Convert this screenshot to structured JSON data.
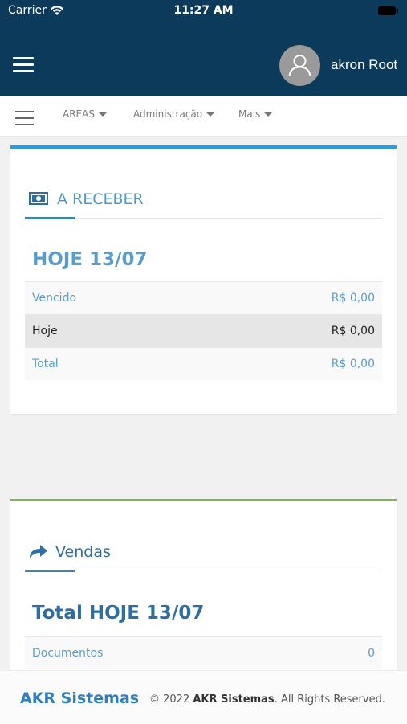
{
  "status_bar": {
    "carrier": "Carrier",
    "time": "11:27 AM"
  },
  "app_bar": {
    "username": "akron Root"
  },
  "nav": {
    "items": [
      {
        "label": "AREAS"
      },
      {
        "label": "Administração"
      },
      {
        "label": "Mais"
      }
    ]
  },
  "receivables_card": {
    "title": "A RECEBER",
    "date_heading": "HOJE 13/07",
    "rows": [
      {
        "label": "Vencido",
        "value": "R$ 0,00"
      },
      {
        "label": "Hoje",
        "value": "R$ 0,00"
      },
      {
        "label": "Total",
        "value": "R$ 0,00"
      }
    ]
  },
  "sales_card": {
    "title": "Vendas",
    "date_heading": "Total HOJE 13/07",
    "rows": [
      {
        "label": "Documentos",
        "value": "0"
      }
    ]
  },
  "footer": {
    "brand": "AKR Sistemas",
    "copyright_prefix": "© 2022 ",
    "copyright_company": "AKR Sistemas",
    "copyright_suffix": ". All Rights Reserved."
  },
  "colors": {
    "header_bg": "#0b3a5a",
    "accent_blue": "#1ea1e8",
    "accent_green": "#7cbc3f",
    "link_blue": "#5b9dca"
  }
}
